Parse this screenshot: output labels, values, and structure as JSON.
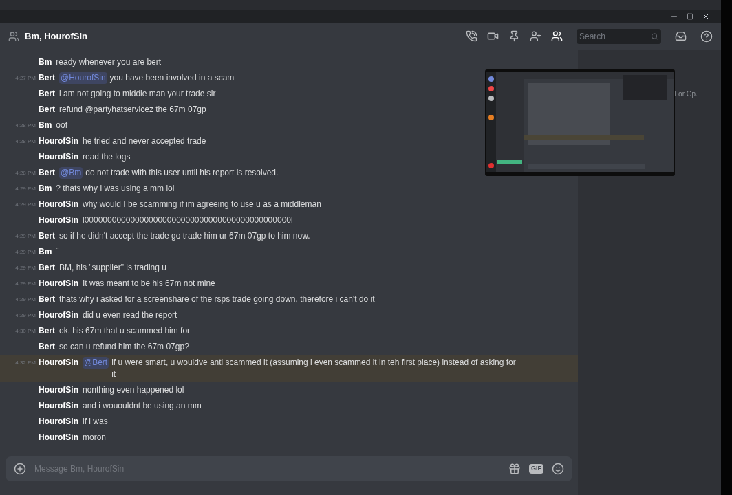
{
  "channel": {
    "title": "Bm, HourofSin"
  },
  "search": {
    "placeholder": "Search"
  },
  "messages": [
    {
      "author": "Bm",
      "text": "ready whenever you are bert",
      "highlighted": false
    },
    {
      "time": "4:27 PM",
      "author": "Bert",
      "mention": "@HourofSin",
      "text": "you have been involved in a scam",
      "highlighted": false
    },
    {
      "author": "Bert",
      "text": "i am not going to middle man your trade sir",
      "highlighted": false
    },
    {
      "author": "Bert",
      "text": "refund @partyhatservicez the 67m 07gp",
      "highlighted": false
    },
    {
      "time": "4:28 PM",
      "author": "Bm",
      "text": "oof",
      "highlighted": false
    },
    {
      "time": "4:28 PM",
      "author": "HourofSin",
      "text": "he tried and never accepted trade",
      "highlighted": false
    },
    {
      "author": "HourofSin",
      "text": "read the logs",
      "highlighted": false
    },
    {
      "time": "4:28 PM",
      "author": "Bert",
      "mention": "@Bm",
      "text": "do not trade with this user until his report is resolved.",
      "highlighted": false
    },
    {
      "time": "4:29 PM",
      "author": "Bm",
      "text": "? thats why i was using a mm lol",
      "highlighted": false
    },
    {
      "time": "4:29 PM",
      "author": "HourofSin",
      "text": "why would I be scamming if im agreeing to use u as a middleman",
      "highlighted": false
    },
    {
      "author": "HourofSin",
      "text": "l000000000000000000000000000000000000000000000l",
      "highlighted": false
    },
    {
      "time": "4:29 PM",
      "author": "Bert",
      "text": "so if he didn't accept the trade go trade him ur 67m 07gp to him now.",
      "highlighted": false
    },
    {
      "time": "4:29 PM",
      "author": "Bm",
      "text": "ˆ",
      "highlighted": false
    },
    {
      "time": "4:29 PM",
      "author": "Bert",
      "text": "BM, his \"supplier\" is trading u",
      "highlighted": false
    },
    {
      "time": "4:29 PM",
      "author": "HourofSin",
      "text": "It was meant to be his 67m not mine",
      "highlighted": false
    },
    {
      "time": "4:29 PM",
      "author": "Bert",
      "text": "thats why i asked for a screenshare of the rsps trade going down, therefore i can't do it",
      "highlighted": false
    },
    {
      "time": "4:29 PM",
      "author": "HourofSin",
      "text": "did u even read the report",
      "highlighted": false
    },
    {
      "time": "4:30 PM",
      "author": "Bert",
      "text": "ok. his 67m that u scammed him for",
      "highlighted": false
    },
    {
      "author": "Bert",
      "text": "so can u refund him the 67m 07gp?",
      "highlighted": false
    },
    {
      "time": "4:32 PM",
      "author": "HourofSin",
      "mention": "@Bert",
      "text": "if u were smart, u wouldve anti scammed it (assuming i even scammed it in teh first place) instead of asking for it",
      "highlighted": true
    },
    {
      "author": "HourofSin",
      "text": "nonthing even happened lol",
      "highlighted": false
    },
    {
      "author": "HourofSin",
      "text": "and i wououldnt be using an mm",
      "highlighted": false
    },
    {
      "author": "HourofSin",
      "text": "if i was",
      "highlighted": false
    },
    {
      "author": "HourofSin",
      "text": "moron",
      "highlighted": false
    }
  ],
  "composer": {
    "placeholder": "Message Bm, HourofSin",
    "gif_label": "GIF"
  },
  "members": {
    "text": "For Gp."
  }
}
